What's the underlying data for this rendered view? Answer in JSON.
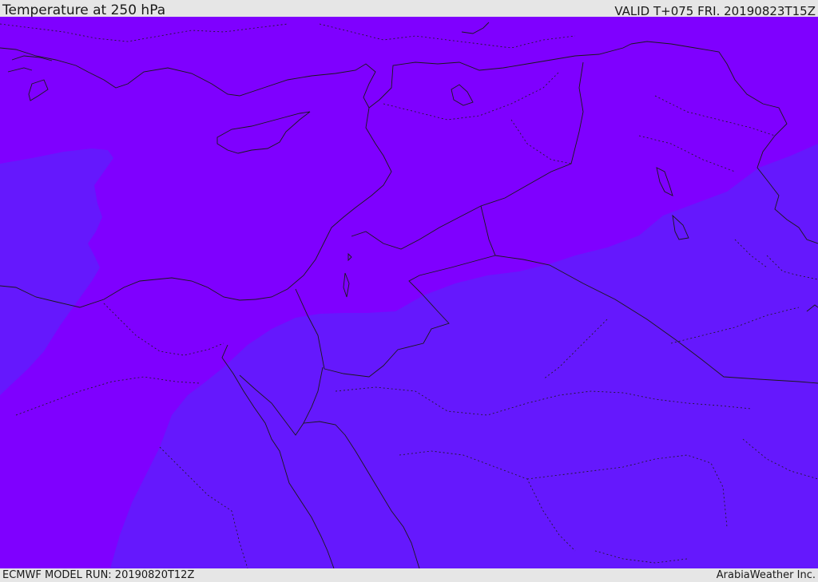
{
  "header": {
    "title": "Temperature at 250 hPa",
    "valid_time": "VALID T+075 FRI. 20190823T15Z"
  },
  "footer": {
    "model_run": "ECMWF MODEL RUN: 20190820T12Z",
    "credit": "ArabiaWeather Inc."
  },
  "map": {
    "fill_colors": {
      "warmer_band": "#7f00ff",
      "cooler_band": "#6518fd"
    },
    "line_colors": {
      "coastline_and_borders": "#1a1a1a"
    }
  }
}
